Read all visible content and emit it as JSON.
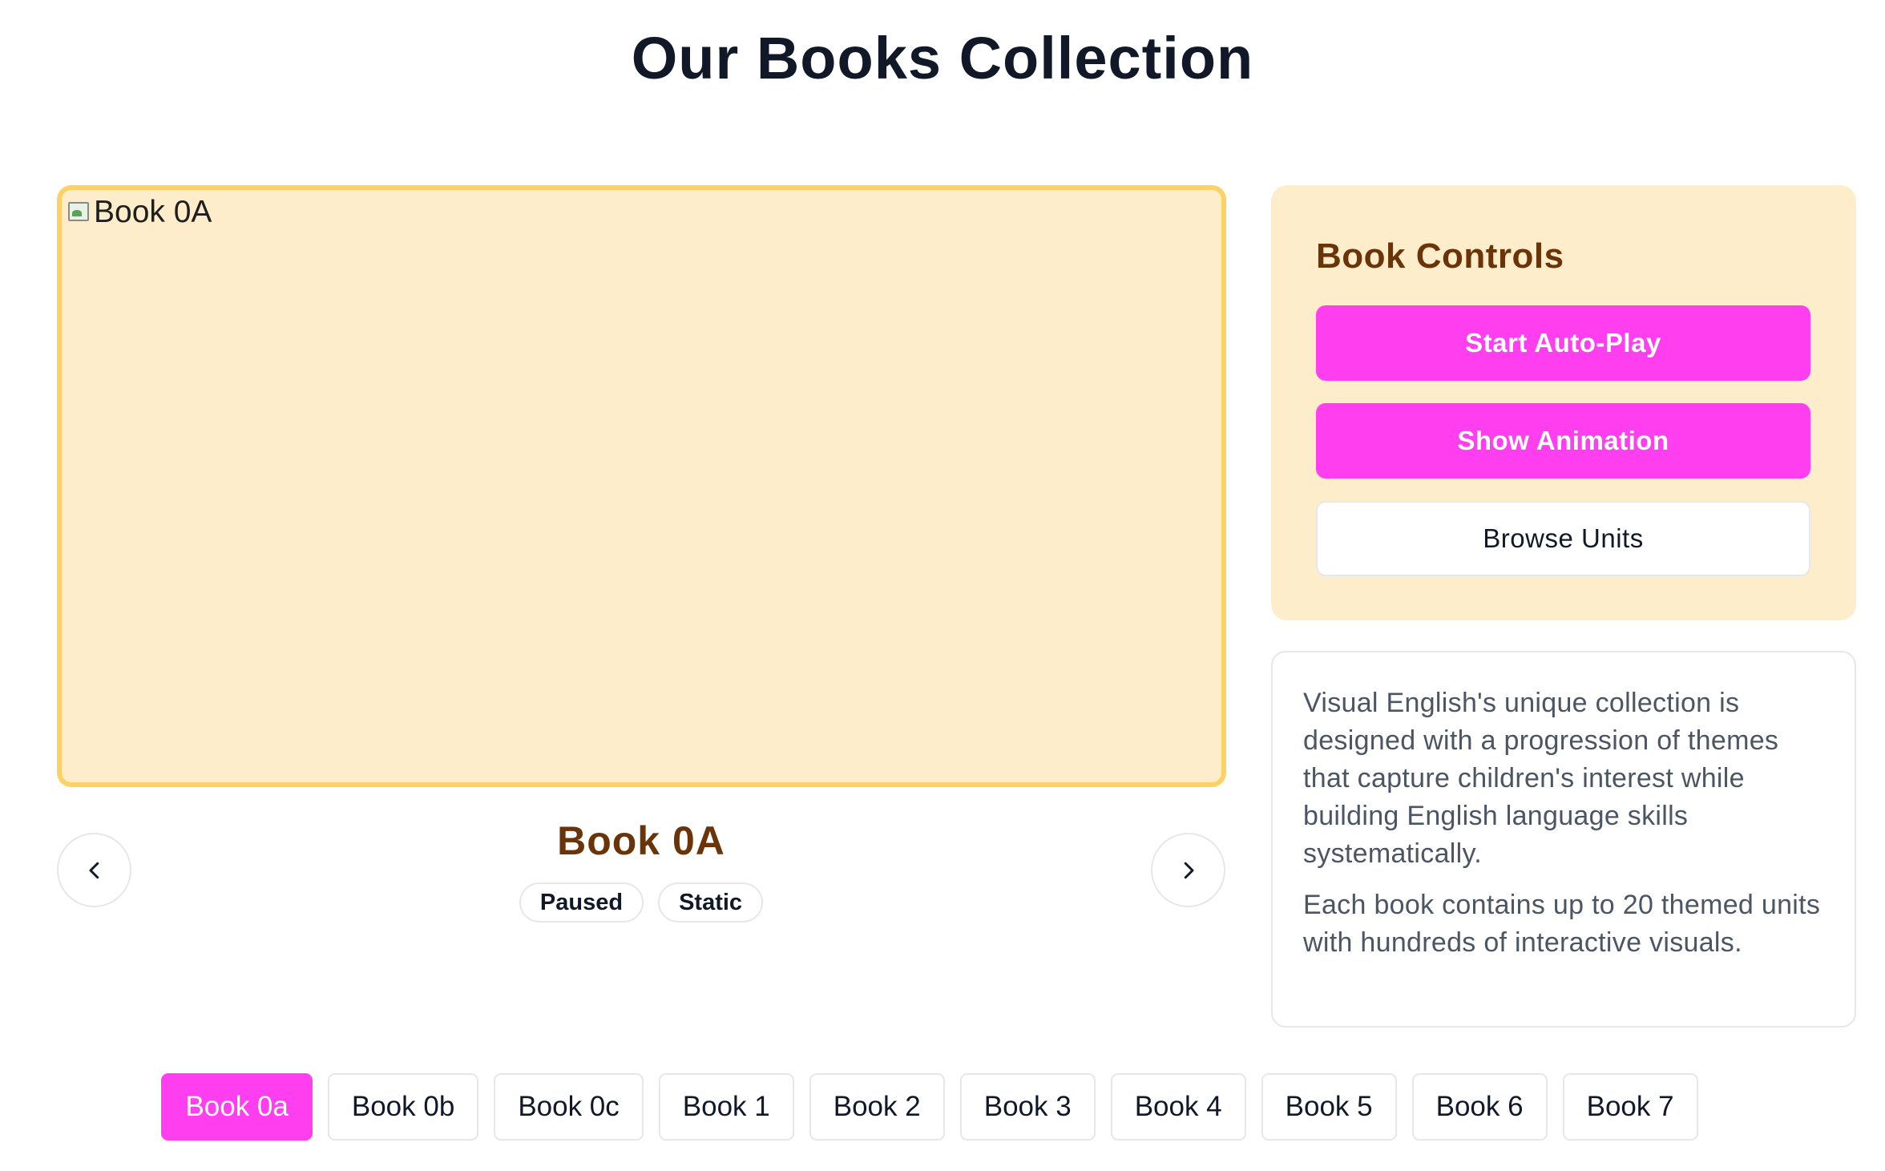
{
  "page": {
    "title": "Our Books Collection"
  },
  "viewer": {
    "image_alt": "Book 0A",
    "book_name": "Book 0A",
    "badges": [
      "Paused",
      "Static"
    ],
    "prev_icon": "chevron-left-icon",
    "next_icon": "chevron-right-icon"
  },
  "controls": {
    "title": "Book Controls",
    "autoplay_label": "Start Auto-Play",
    "animation_label": "Show Animation",
    "browse_label": "Browse Units"
  },
  "description": {
    "paragraphs": [
      "Visual English's unique collection is designed with a progression of themes that capture children's interest while building English language skills systematically.",
      "Each book contains up to 20 themed units with hundreds of interactive visuals."
    ]
  },
  "book_tabs": {
    "active_index": 0,
    "items": [
      "Book 0a",
      "Book 0b",
      "Book 0c",
      "Book 1",
      "Book 2",
      "Book 3",
      "Book 4",
      "Book 5",
      "Book 6",
      "Book 7"
    ]
  },
  "colors": {
    "accent": "#ff3ef0",
    "panel_bg": "#feedca",
    "viewer_border": "#fcd165",
    "heading_brown": "#6b3408"
  }
}
